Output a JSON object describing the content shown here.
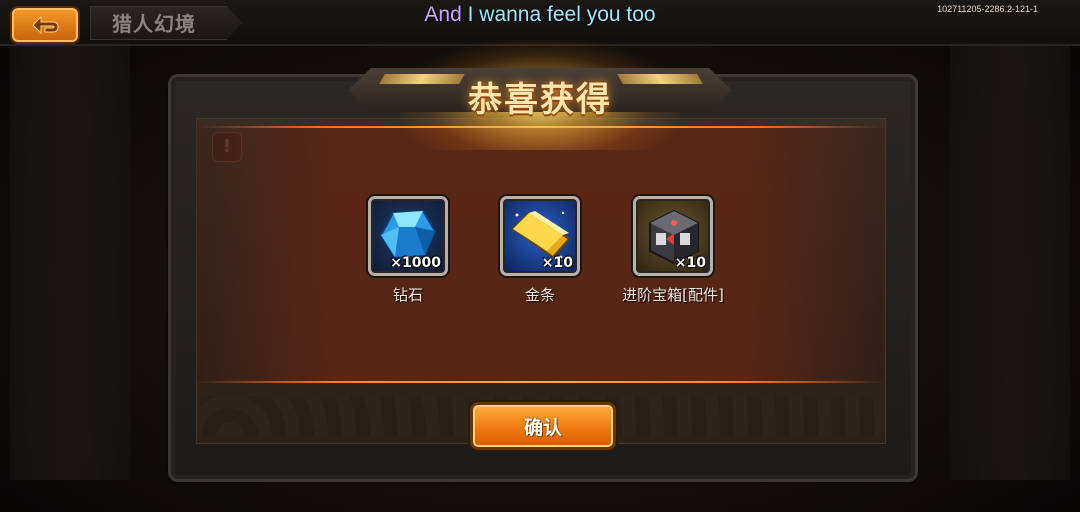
{
  "top_bar": {
    "title": "猎人幻境",
    "subtitle_highlight": "And",
    "subtitle_rest": " I wanna feel you too",
    "build_id": "102711205-2286.2-121-1"
  },
  "dialog": {
    "title": "恭喜获得",
    "confirm_label": "确认"
  },
  "rewards": [
    {
      "name": "钻石",
      "quantity": "×1000",
      "icon": "diamond-icon"
    },
    {
      "name": "金条",
      "quantity": "×10",
      "icon": "gold-bar-icon"
    },
    {
      "name": "进阶宝箱[配件]",
      "quantity": "×10",
      "icon": "advanced-chest-icon"
    }
  ],
  "colors": {
    "accent_orange": "#f07a10",
    "title_gold": "#ffe6b0",
    "subtitle_cyan": "#9fe7ff",
    "subtitle_purple": "#c8a8ff"
  }
}
